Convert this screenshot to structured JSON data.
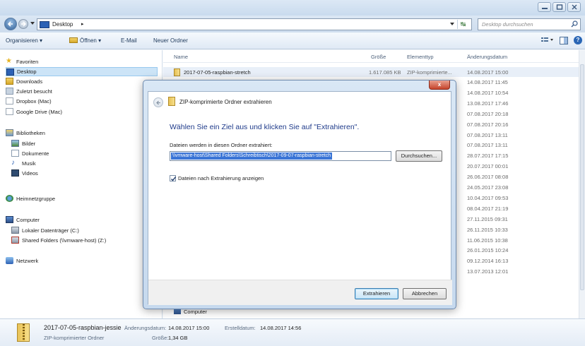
{
  "window": {
    "address": {
      "location": "Desktop",
      "arrow": "▸"
    },
    "search_placeholder": "Desktop durchsuchen"
  },
  "toolbar": {
    "organize": "Organisieren ▾",
    "open": "Öffnen ▾",
    "email": "E-Mail",
    "new_folder": "Neuer Ordner"
  },
  "navpane": {
    "favorites_header": "Favoriten",
    "favorites": [
      "Desktop",
      "Downloads",
      "Zuletzt besucht",
      "Dropbox (Mac)",
      "Google Drive (Mac)"
    ],
    "libraries_header": "Bibliotheken",
    "libraries": [
      "Bilder",
      "Dokumente",
      "Musik",
      "Videos"
    ],
    "homegroup": "Heimnetzgruppe",
    "computer_header": "Computer",
    "computer": [
      "Lokaler Datenträger (C:)",
      "Shared Folders (\\\\vmware-host) (Z:)"
    ],
    "network": "Netzwerk"
  },
  "filelist": {
    "columns": {
      "name": "Name",
      "size": "Größe",
      "type": "Elementtyp",
      "date": "Änderungsdatum"
    },
    "first_row": {
      "name": "2017-07-05-raspbian-stretch",
      "size": "1.617.085 KB",
      "type": "ZIP-komprimierte...",
      "date": "14.08.2017 15:00"
    },
    "dates": [
      "14.08.2017 11:45",
      "14.08.2017 10:54",
      "13.08.2017 17:46",
      "07.08.2017 20:18",
      "07.08.2017 20:16",
      "07.08.2017 13:11",
      "07.08.2017 13:11",
      "28.07.2017 17:15",
      "20.07.2017 00:01",
      "26.06.2017 08:08",
      "24.05.2017 23:08",
      "10.04.2017 09:53",
      "08.04.2017 21:19",
      "27.11.2015 09:31",
      "26.11.2015 10:33",
      "11.06.2015 10:38",
      "26.01.2015 10:24",
      "09.12.2014 16:13",
      "13.07.2013 12:01"
    ],
    "last_row": "Computer"
  },
  "details": {
    "filename": "2017-07-05-raspbian-jessie",
    "type": "ZIP-komprimierter Ordner",
    "modified_label": "Änderungsdatum:",
    "modified": "14.08.2017 15:00",
    "size_label": "Größe:",
    "size": "1,34 GB",
    "created_label": "Erstelldatum:",
    "created": "14.08.2017 14:56"
  },
  "dialog": {
    "title": "ZIP-komprimierte Ordner extrahieren",
    "heading": "Wählen Sie ein Ziel aus und klicken Sie auf \"Extrahieren\".",
    "folder_label": "Dateien werden in diesen Ordner extrahiert:",
    "folder_value": "\\\\vmware-host\\Shared Folders\\Schreibtisch\\2017-09-07-raspbian-stretch",
    "browse": "Durchsuchen...",
    "show_files": "Dateien nach Extrahierung anzeigen",
    "extract": "Extrahieren",
    "cancel": "Abbrechen",
    "close": "x"
  }
}
